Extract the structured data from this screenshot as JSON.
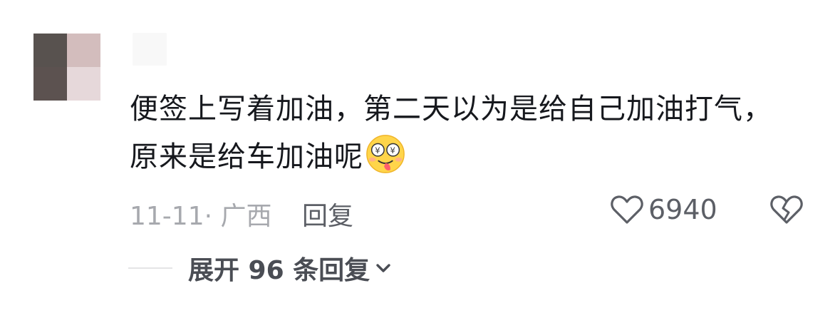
{
  "comment": {
    "text": "便签上写着加油，第二天以为是给自己加油打气，原来是给车加油呢",
    "emoji": "star-struck-tongue-emoji"
  },
  "meta": {
    "date_location": "11-11· 广西",
    "reply_label": "回复",
    "like_count": "6940"
  },
  "expand": {
    "label": "展开 96 条回复"
  },
  "colors": {
    "text_primary": "#16181d",
    "text_muted": "#a7a9ae",
    "icon_gray": "#5c5f66"
  }
}
